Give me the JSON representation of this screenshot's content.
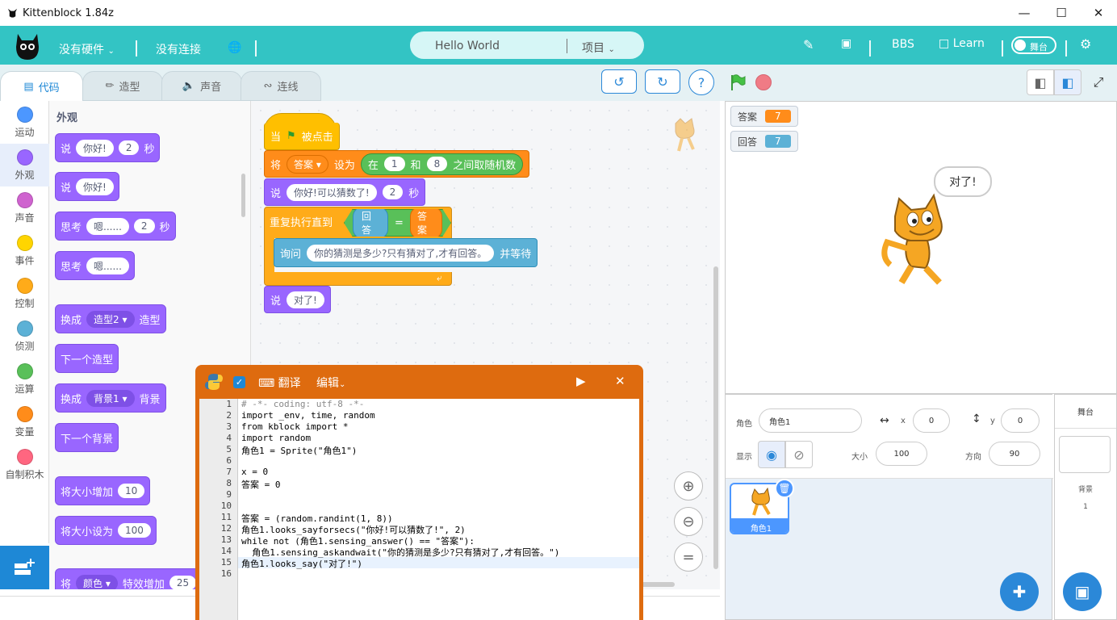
{
  "app": {
    "title": "Kittenblock 1.84z"
  },
  "menubar": {
    "hardware": "没有硬件",
    "connection": "没有连接",
    "project_name": "Hello World",
    "project_menu": "项目",
    "bbs": "BBS",
    "learn": "Learn",
    "stage_toggle": "舞台"
  },
  "tabs": {
    "code": "代码",
    "costume": "造型",
    "sound": "声音",
    "connect": "连线"
  },
  "categories": [
    {
      "label": "运动",
      "color": "#4c97ff"
    },
    {
      "label": "外观",
      "color": "#9966ff"
    },
    {
      "label": "声音",
      "color": "#cf63cf"
    },
    {
      "label": "事件",
      "color": "#ffd500"
    },
    {
      "label": "控制",
      "color": "#ffab19"
    },
    {
      "label": "侦测",
      "color": "#5cb1d6"
    },
    {
      "label": "运算",
      "color": "#59c059"
    },
    {
      "label": "变量",
      "color": "#ff8c1a"
    },
    {
      "label": "自制积木",
      "color": "#ff6680"
    }
  ],
  "palette": {
    "heading": "外观",
    "say_secs": {
      "verb": "说",
      "text": "你好!",
      "secs": "2",
      "unit": "秒"
    },
    "say": {
      "verb": "说",
      "text": "你好!"
    },
    "think_secs": {
      "verb": "思考",
      "text": "嗯......",
      "secs": "2",
      "unit": "秒"
    },
    "think": {
      "verb": "思考",
      "text": "嗯......"
    },
    "switch_costume": {
      "verb": "换成",
      "value": "造型2",
      "suffix": "造型"
    },
    "next_costume": "下一个造型",
    "switch_backdrop": {
      "verb": "换成",
      "value": "背景1",
      "suffix": "背景"
    },
    "next_backdrop": "下一个背景",
    "change_size": {
      "label": "将大小增加",
      "value": "10"
    },
    "set_size": {
      "label": "将大小设为",
      "value": "100"
    },
    "change_effect": {
      "verb": "将",
      "effect": "颜色",
      "label": "特效增加",
      "value": "25"
    }
  },
  "script": {
    "when_flag": {
      "pre": "当",
      "post": "被点击"
    },
    "set_var": {
      "verb": "将",
      "var": "答案",
      "to": "设为",
      "in": "在",
      "from": "1",
      "and": "和",
      "to_val": "8",
      "random": "之间取随机数"
    },
    "say_secs": {
      "verb": "说",
      "text": "你好!可以猜数了!",
      "secs": "2",
      "unit": "秒"
    },
    "repeat_until": {
      "label": "重复执行直到",
      "left": "回答",
      "eq": "=",
      "right": "答案"
    },
    "ask": {
      "verb": "询问",
      "text": "你的猜测是多少?只有猜对了,才有回答。",
      "suffix": "并等待"
    },
    "say_final": {
      "verb": "说",
      "text": "对了!"
    }
  },
  "codewin": {
    "translate": "翻译",
    "edit": "编辑",
    "lines": [
      "# -*- coding: utf-8 -*-",
      "import _env, time, random",
      "from kblock import *",
      "import random",
      "角色1 = Sprite(\"角色1\")",
      "",
      "x = 0",
      "答案 = 0",
      "",
      "",
      "答案 = (random.randint(1, 8))",
      "角色1.looks_sayforsecs(\"你好!可以猜数了!\", 2)",
      "while not (角色1.sensing_answer() == \"答案\"):",
      "  角色1.sensing_askandwait(\"你的猜测是多少?只有猜对了,才有回答。\")",
      "角色1.looks_say(\"对了!\")",
      ""
    ]
  },
  "stage": {
    "monitors": [
      {
        "label": "答案",
        "value": "7",
        "color": "#ff8c1a"
      },
      {
        "label": "回答",
        "value": "7",
        "color": "#5cb1d6"
      }
    ],
    "bubble": "对了!"
  },
  "sprite": {
    "label_sprite": "角色",
    "name": "角色1",
    "label_x": "x",
    "x": "0",
    "label_y": "y",
    "y": "0",
    "label_show": "显示",
    "label_size": "大小",
    "size": "100",
    "label_direction": "方向",
    "direction": "90",
    "thumb_name": "角色1"
  },
  "stage_panel": {
    "title": "舞台",
    "backdrop_label": "背景",
    "backdrop_count": "1"
  }
}
